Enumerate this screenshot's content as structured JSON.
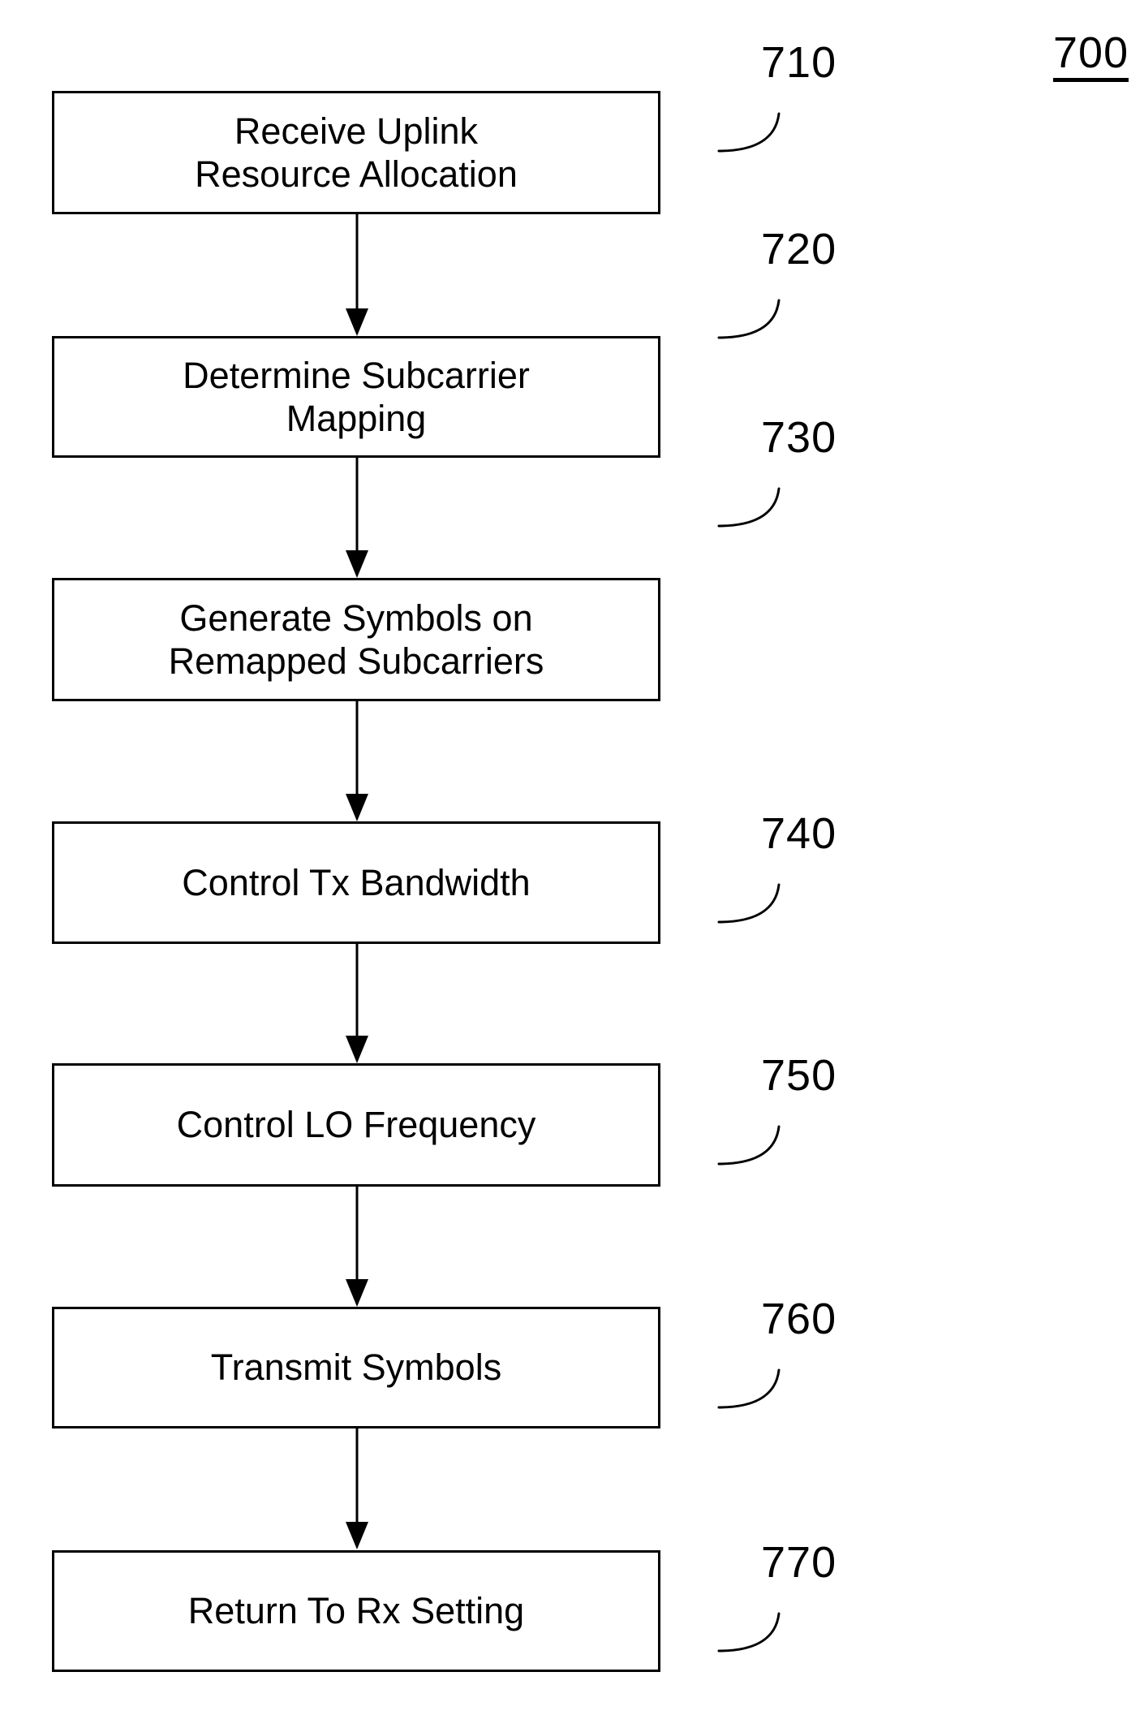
{
  "figure": {
    "number": "700",
    "type": "flowchart"
  },
  "diagram_data": {
    "type": "flowchart",
    "orientation": "vertical",
    "title": "700",
    "node_count": 7,
    "nodes": [
      {
        "ref": "710",
        "label": "Receive Uplink\nResource Allocation",
        "lines": 2
      },
      {
        "ref": "720",
        "label": "Determine Subcarrier\nMapping",
        "lines": 2
      },
      {
        "ref": "730",
        "label": "Generate Symbols on\nRemapped Subcarriers",
        "lines": 2
      },
      {
        "ref": "740",
        "label": "Control Tx Bandwidth",
        "lines": 1
      },
      {
        "ref": "750",
        "label": "Control LO Frequency",
        "lines": 1
      },
      {
        "ref": "760",
        "label": "Transmit Symbols",
        "lines": 1
      },
      {
        "ref": "770",
        "label": "Return To Rx Setting",
        "lines": 1
      }
    ],
    "edges": [
      {
        "from": "710",
        "to": "720",
        "style": "arrow"
      },
      {
        "from": "720",
        "to": "730",
        "style": "arrow"
      },
      {
        "from": "730",
        "to": "740",
        "style": "arrow"
      },
      {
        "from": "740",
        "to": "750",
        "style": "arrow"
      },
      {
        "from": "750",
        "to": "760",
        "style": "arrow"
      },
      {
        "from": "760",
        "to": "770",
        "style": "arrow"
      }
    ],
    "colors": {
      "stroke": "#000000",
      "fill": "#ffffff",
      "text": "#000000"
    }
  },
  "steps": [
    {
      "ref": "710",
      "label": "Receive Uplink\nResource Allocation"
    },
    {
      "ref": "720",
      "label": "Determine Subcarrier\nMapping"
    },
    {
      "ref": "730",
      "label": "Generate Symbols on\nRemapped Subcarriers"
    },
    {
      "ref": "740",
      "label": "Control Tx Bandwidth"
    },
    {
      "ref": "750",
      "label": "Control LO Frequency"
    },
    {
      "ref": "760",
      "label": "Transmit Symbols"
    },
    {
      "ref": "770",
      "label": "Return To Rx Setting"
    }
  ]
}
